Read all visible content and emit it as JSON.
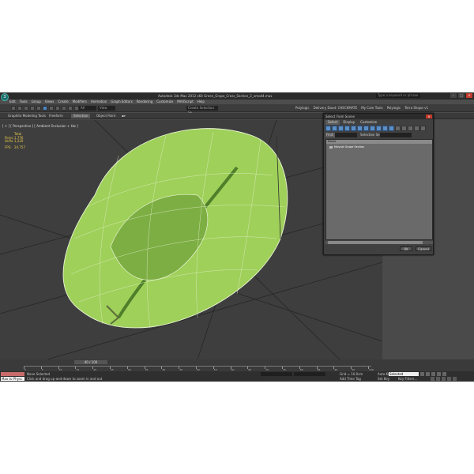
{
  "window": {
    "title": "Autodesk 3ds Max 2012 x64    Green_Grape_Cross_Section_2_vmod4.max",
    "search_placeholder": "Type a keyword or phrase"
  },
  "menu": [
    "Edit",
    "Tools",
    "Group",
    "Views",
    "Create",
    "Modifiers",
    "Animation",
    "Graph Editors",
    "Rendering",
    "Customize",
    "MAXScript",
    "Help"
  ],
  "toolbar": {
    "selection_filter": "All",
    "view_dropdown": "View",
    "named_selection": "Create Selection Se",
    "right_labels": [
      "Polylogic",
      "Delivery Dood: CHECKMATE",
      "My Cam Tools",
      "Polylogic",
      "Terra Shape v1"
    ]
  },
  "ribbon": {
    "tabs": [
      "Graphite Modeling Tools",
      "Freeform",
      "Selection",
      "Object Paint"
    ],
    "active_tab": "Selection"
  },
  "viewport": {
    "label": "[ + ] [ Perspective ] [ Ambient Occlusion + Hw ]",
    "stats": {
      "header": "Total",
      "rows": [
        {
          "k": "Polys:",
          "v": "1,776"
        },
        {
          "k": "Verts:",
          "v": "1,220"
        }
      ],
      "fps_label": "FPS:",
      "fps_value": "24.757"
    },
    "mesh_color": "#9fd05a"
  },
  "trackbar": {
    "time": "40 / 100",
    "ticks": [
      "0",
      "5",
      "10",
      "15",
      "20",
      "25",
      "30",
      "35",
      "40",
      "45",
      "50",
      "55",
      "60",
      "65",
      "70",
      "75",
      "80",
      "85",
      "90",
      "95",
      "100"
    ]
  },
  "status": {
    "maxscript_top": "",
    "maxscript_bottom": "Max to Physc",
    "selection": "None Selected",
    "prompt": "Click and drag up-and-down to zoom in and out",
    "grid": "Grid = 10.0cm",
    "add_time_tag": "Add Time Tag",
    "auto_key": "Auto Key",
    "auto_key_value": "Selected",
    "set_key": "Set Key",
    "key_filters": "Key Filters..."
  },
  "dialog": {
    "title": "Select From Scene",
    "tabs": [
      "Select",
      "Display",
      "Customize"
    ],
    "active_tab": "Select",
    "find_label": "Find:",
    "selection_set_label": "Selection Set:",
    "column_header": "Name",
    "item": "Muscat Grape Section",
    "ok": "OK",
    "cancel": "Cancel"
  }
}
